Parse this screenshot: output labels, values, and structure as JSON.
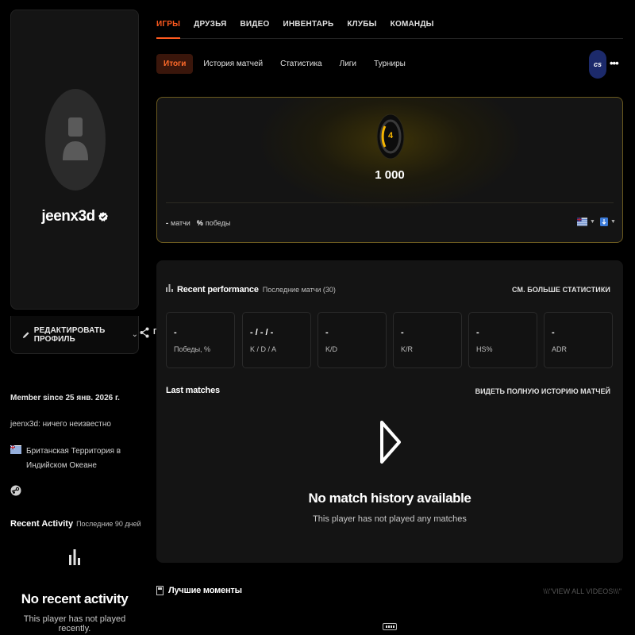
{
  "profile": {
    "username": "jeenx3d",
    "edit_label": "РЕДАКТИРОВАТЬ ПРОФИЛЬ",
    "share_label": "Г",
    "member_since": "Member since 25 янв. 2026 г.",
    "bio": "jeenx3d: ничего неизвестно",
    "country": "Британская Территория в Индийском Океане"
  },
  "recent_activity": {
    "title": "Recent Activity",
    "period": "Последние 90 дней",
    "empty_title": "No recent activity",
    "empty_sub": "This player has not played recently."
  },
  "top_nav": {
    "tabs": [
      {
        "label": "ИГРЫ",
        "active": true
      },
      {
        "label": "ДРУЗЬЯ",
        "active": false
      },
      {
        "label": "ВИДЕО",
        "active": false
      },
      {
        "label": "ИНВЕНТАРЬ",
        "active": false
      },
      {
        "label": "КЛУБЫ",
        "active": false
      },
      {
        "label": "КОМАНДЫ",
        "active": false
      }
    ]
  },
  "sub_nav": {
    "tabs": [
      {
        "label": "Итоги",
        "active": true
      },
      {
        "label": "История матчей",
        "active": false
      },
      {
        "label": "Статистика",
        "active": false
      },
      {
        "label": "Лиги",
        "active": false
      },
      {
        "label": "Турниры",
        "active": false
      }
    ],
    "game_logo": "cs",
    "more_label": "•••"
  },
  "rank": {
    "level": "4",
    "elo": "1 000",
    "matches_value": "-",
    "matches_label": "матчи",
    "wins_value": "%",
    "wins_label": "победы",
    "accent": "#f5b400"
  },
  "performance": {
    "title": "Recent performance",
    "subtitle": "Последние матчи (30)",
    "more_label": "СМ. БОЛЬШЕ СТАТИСТИКИ",
    "stats": [
      {
        "value": "-",
        "label": "Победы, %"
      },
      {
        "value": "- / - / -",
        "label": "K / D / A"
      },
      {
        "value": "-",
        "label": "K/D"
      },
      {
        "value": "-",
        "label": "K/R"
      },
      {
        "value": "-",
        "label": "HS%"
      },
      {
        "value": "-",
        "label": "ADR"
      }
    ]
  },
  "last_matches": {
    "title": "Last matches",
    "more_label": "ВИДЕТЬ ПОЛНУЮ ИСТОРИЮ МАТЧЕЙ",
    "empty_title": "No match history available",
    "empty_sub": "This player has not played any matches"
  },
  "highlights": {
    "title": "Лучшие моменты",
    "more_label": "\\\\\\\"VIEW ALL VIDEOS\\\\\\\""
  },
  "colors": {
    "accent_orange": "#ff5a1f",
    "background": "#000000",
    "card": "#141414"
  }
}
